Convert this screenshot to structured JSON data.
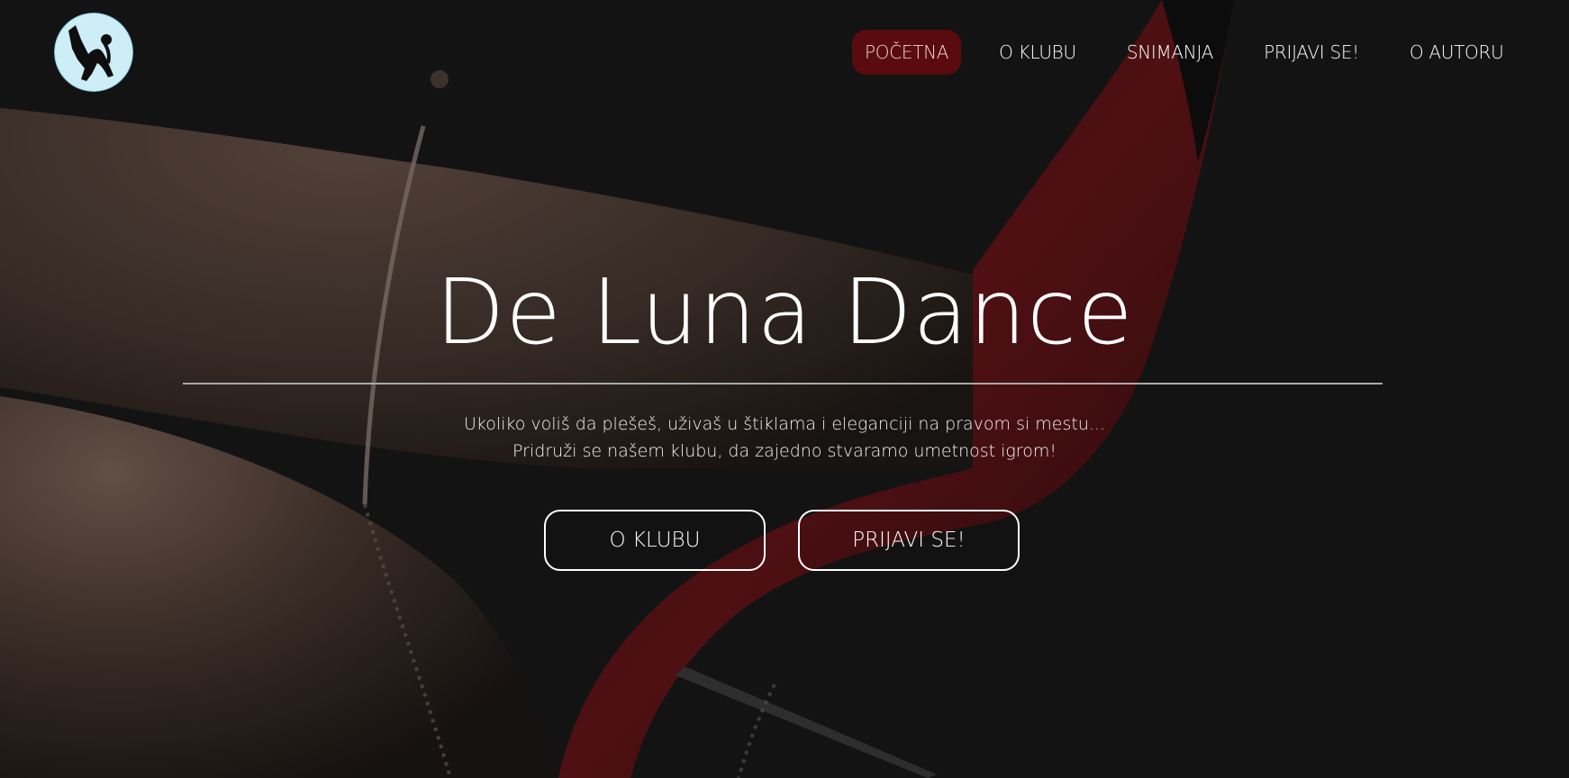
{
  "nav": {
    "items": [
      {
        "label": "POČETNA",
        "active": true
      },
      {
        "label": "O KLUBU",
        "active": false
      },
      {
        "label": "SNIMANJA",
        "active": false
      },
      {
        "label": "PRIJAVI SE!",
        "active": false
      },
      {
        "label": "O AUTORU",
        "active": false
      }
    ],
    "active_color": "#5a0b0e"
  },
  "hero": {
    "title": "De Luna Dance",
    "tagline_line1": "Ukoliko voliš da plešeš, uživaš u štiklama i eleganciji na pravom si mestu...",
    "tagline_line2": "Pridruži se našem klubu, da zajedno stvaramo umetnost igrom!",
    "primary_button": "O KLUBU",
    "secondary_button": "PRIJAVI SE!"
  },
  "logo": {
    "icon": "dancer-silhouette-moon-icon",
    "color": "#bfe6f2"
  },
  "background": {
    "image": "leg-with-anklet-and-red-high-heel",
    "accent": "#7a0d12"
  }
}
